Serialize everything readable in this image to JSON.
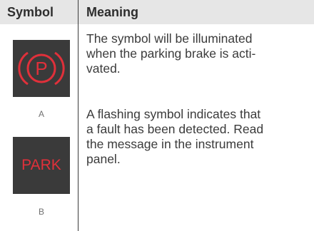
{
  "table": {
    "header": {
      "symbol": "Symbol",
      "meaning": "Meaning"
    },
    "symbols": [
      {
        "label": "A",
        "icon": "parking-brake-circle-p-icon",
        "color": "#e0303a"
      },
      {
        "label": "B",
        "icon": "park-text-icon",
        "text": "PARK",
        "color": "#e0303a"
      }
    ],
    "meaning": {
      "p1_lines": [
        "The symbol will be illuminated",
        "when the parking brake is acti-",
        "vated."
      ],
      "p2_lines": [
        "A flashing symbol indicates that",
        "a fault has been detected. Read",
        "the message in the instrument",
        "panel."
      ]
    }
  }
}
